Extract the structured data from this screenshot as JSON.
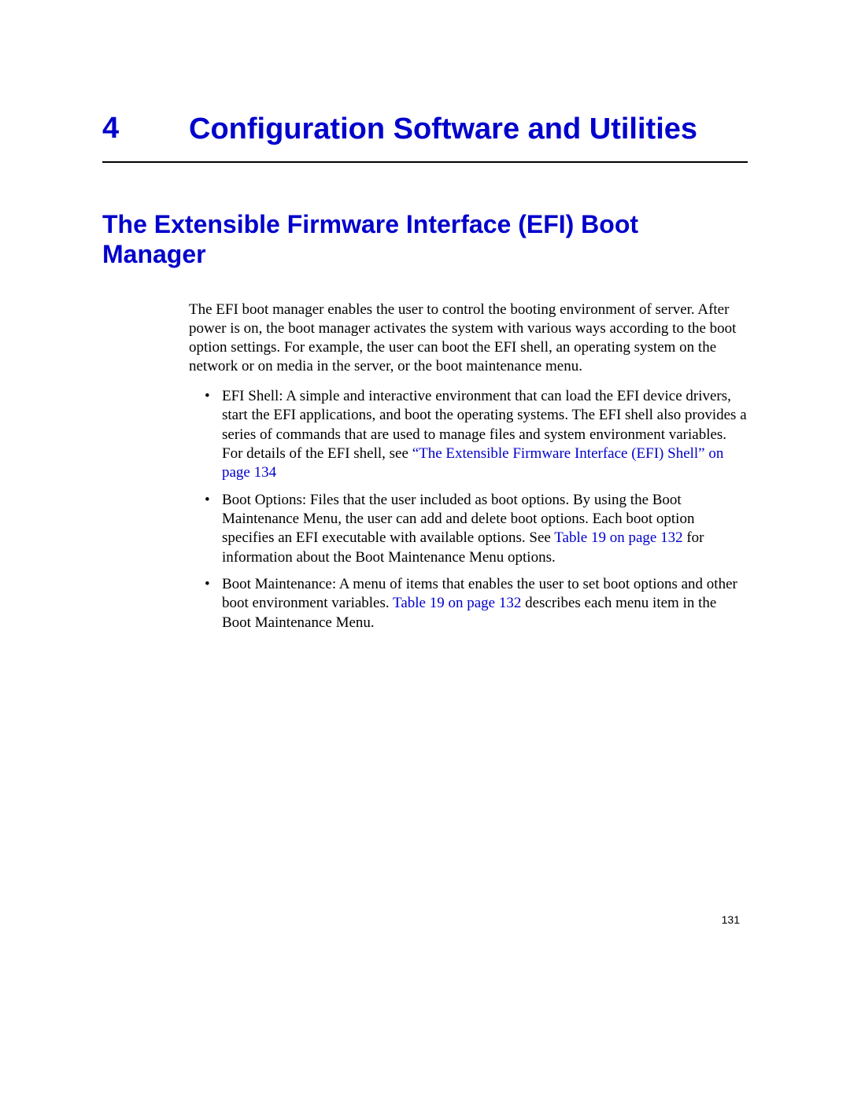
{
  "chapter": {
    "number": "4",
    "title": "Configuration Software and Utilities"
  },
  "section": {
    "title": "The Extensible Firmware Interface (EFI) Boot Manager",
    "intro": "The EFI boot manager enables the user to control the booting environment of server. After power is on, the boot manager activates the system with various ways according to the boot option settings. For example, the user can boot the EFI shell, an operating system on the network or on media in the server, or the boot maintenance menu."
  },
  "bullets": [
    {
      "pre": "EFI Shell: A simple and interactive environment that can load the EFI device drivers, start the EFI applications, and boot the operating systems. The EFI shell also provides a series of commands that are used to manage files and system environment variables. For details of the EFI shell, see ",
      "link": "“The Extensible Firmware Interface (EFI) Shell” on page 134",
      "post": ""
    },
    {
      "pre": "Boot Options: Files that the user included as boot options. By using the Boot Maintenance Menu, the user can add and delete boot options. Each boot option specifies an EFI executable with available options. See ",
      "link": "Table 19 on page 132",
      "post": " for information about the Boot Maintenance Menu options."
    },
    {
      "pre": "Boot Maintenance: A menu of items that enables the user to set boot options and other boot environment variables. ",
      "link": "Table 19 on page 132",
      "post": " describes each menu item in the Boot Maintenance Menu."
    }
  ],
  "pageNumber": "131"
}
